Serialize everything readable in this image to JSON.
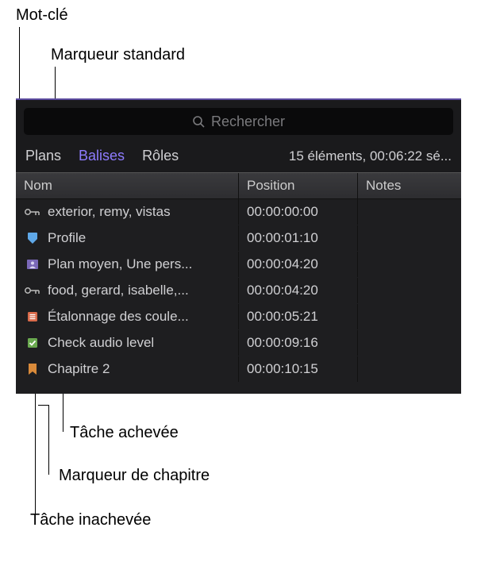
{
  "callouts": {
    "keyword": "Mot-clé",
    "standard_marker": "Marqueur standard",
    "completed_todo": "Tâche achevée",
    "chapter_marker": "Marqueur de chapitre",
    "incomplete_todo": "Tâche inachevée"
  },
  "search": {
    "placeholder": "Rechercher"
  },
  "tabs": {
    "plans": "Plans",
    "balises": "Balises",
    "roles": "Rôles"
  },
  "status": "15 éléments, 00:06:22 sé...",
  "headers": {
    "name": "Nom",
    "position": "Position",
    "notes": "Notes"
  },
  "rows": [
    {
      "icon": "keyword",
      "name": "exterior, remy, vistas",
      "position": "00:00:00:00"
    },
    {
      "icon": "marker",
      "name": "Profile",
      "position": "00:00:01:10"
    },
    {
      "icon": "analysis",
      "name": "Plan moyen, Une pers...",
      "position": "00:00:04:20"
    },
    {
      "icon": "keyword",
      "name": "food, gerard, isabelle,...",
      "position": "00:00:04:20"
    },
    {
      "icon": "todo",
      "name": "Étalonnage des coule...",
      "position": "00:00:05:21"
    },
    {
      "icon": "completed",
      "name": "Check audio level",
      "position": "00:00:09:16"
    },
    {
      "icon": "chapter",
      "name": "Chapitre 2",
      "position": "00:00:10:15"
    }
  ]
}
